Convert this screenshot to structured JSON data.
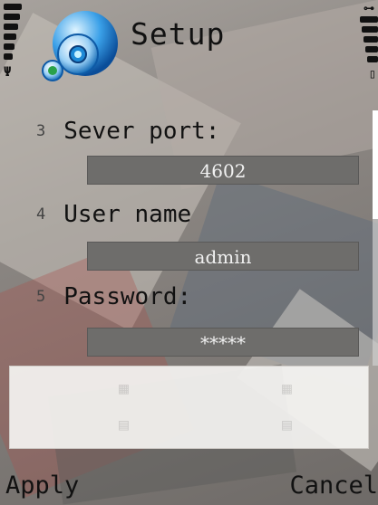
{
  "header": {
    "title": "Setup",
    "signal_icon": "antenna-icon",
    "battery_icon": "battery-icon"
  },
  "form": {
    "fields": [
      {
        "number": "3",
        "label": "Sever port:",
        "value": "4602"
      },
      {
        "number": "4",
        "label": "User name",
        "value": "admin"
      },
      {
        "number": "5",
        "label": "Password:",
        "value": "*****"
      }
    ]
  },
  "softkeys": {
    "left": "Apply",
    "right": "Cancel"
  },
  "colors": {
    "field_bg": "#6e6d6b",
    "field_text": "#f1f1f1",
    "text": "#111111"
  }
}
